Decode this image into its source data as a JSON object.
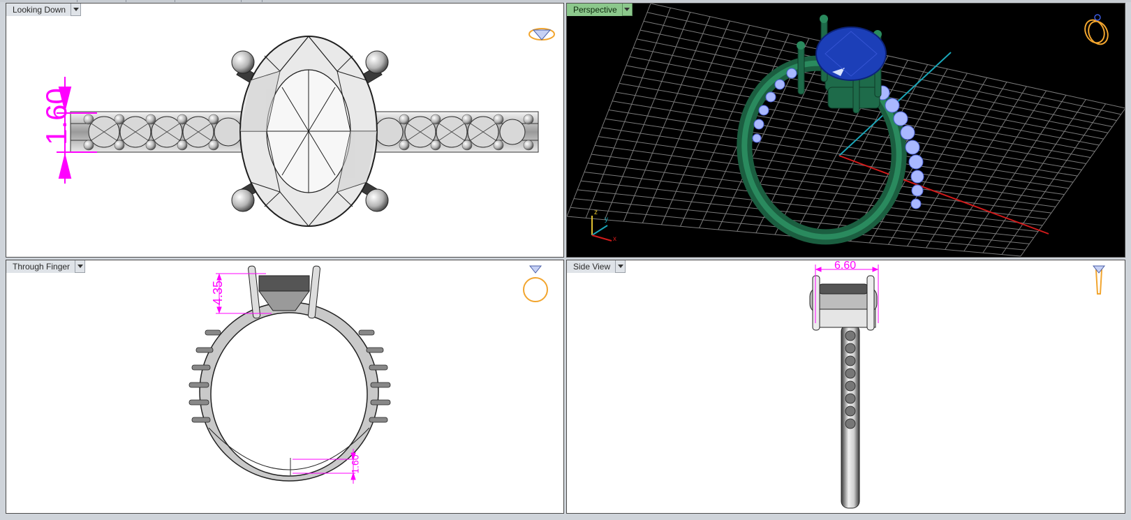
{
  "viewports": {
    "top_left": {
      "title": "Looking Down",
      "dimension": "1.60"
    },
    "top_right": {
      "title": "Perspective",
      "axes": {
        "x": "x",
        "y": "y",
        "z": "z"
      }
    },
    "bottom_left": {
      "title": "Through Finger",
      "dimension_head": "4.35",
      "dimension_shank": "1.60"
    },
    "bottom_right": {
      "title": "Side View",
      "dimension": "6.60"
    }
  },
  "colors": {
    "dimension": "#ff00ff",
    "ring_metal_perspective": "#1e6b4a",
    "center_stone": "#1c3fb8",
    "side_stones": "#a9b8ff",
    "grid": "#6a6a6a",
    "axis_x": "#d11a1a",
    "axis_y": "#1aa6b8",
    "active_viewport_tab": "#8cc88c",
    "view_icon": "#f2a52e"
  },
  "icons": {
    "view_cube_top_left": "ring-top-view-icon",
    "view_cube_top_right": "ring-perspective-view-icon",
    "view_cube_bottom_left": "ring-front-view-icon",
    "view_cube_bottom_right": "ring-side-view-icon"
  }
}
